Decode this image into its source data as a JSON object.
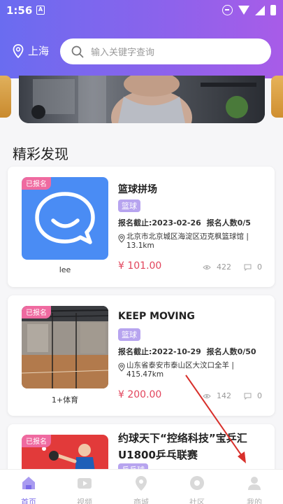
{
  "status_bar": {
    "time": "1:56",
    "notification_glyph": "A"
  },
  "header": {
    "location": "上海",
    "search_placeholder": "输入关键字查询"
  },
  "section_title": "精彩发现",
  "events": [
    {
      "badge": "已报名",
      "org_name": "lee",
      "title": "篮球拼场",
      "category": "篮球",
      "deadline_label": "报名截止:2023-02-26",
      "signups_label": "报名人数0/5",
      "address": "北京市北京城区海淀区迈克枫篮球馆 | 13.1km",
      "price": "¥ 101.00",
      "views": "422",
      "comments": "0"
    },
    {
      "badge": "已报名",
      "org_name": "1+体育",
      "title": "KEEP MOVING",
      "category": "篮球",
      "deadline_label": "报名截止:2022-10-29",
      "signups_label": "报名人数0/50",
      "address": "山东省泰安市泰山区大汶口全羊 | 415.47km",
      "price": "¥ 200.00",
      "views": "142",
      "comments": "0"
    },
    {
      "badge": "已报名",
      "title": "约球天下“控络科技”宝乒汇U1800乒乓联赛",
      "category": "乒乓球"
    }
  ],
  "tabbar": [
    {
      "label": "首页",
      "icon": "home-icon",
      "active": true
    },
    {
      "label": "视频",
      "icon": "video-icon",
      "active": false
    },
    {
      "label": "商城",
      "icon": "location-icon",
      "active": false
    },
    {
      "label": "社区",
      "icon": "community-icon",
      "active": false
    },
    {
      "label": "我的",
      "icon": "profile-icon",
      "active": false
    }
  ],
  "colors": {
    "header_start": "#6a6cf0",
    "header_end": "#a85ce8",
    "badge": "#ef6aa0",
    "category_tag": "#b7a4ef",
    "price": "#e2445c",
    "tab_active": "#7b6be8"
  }
}
